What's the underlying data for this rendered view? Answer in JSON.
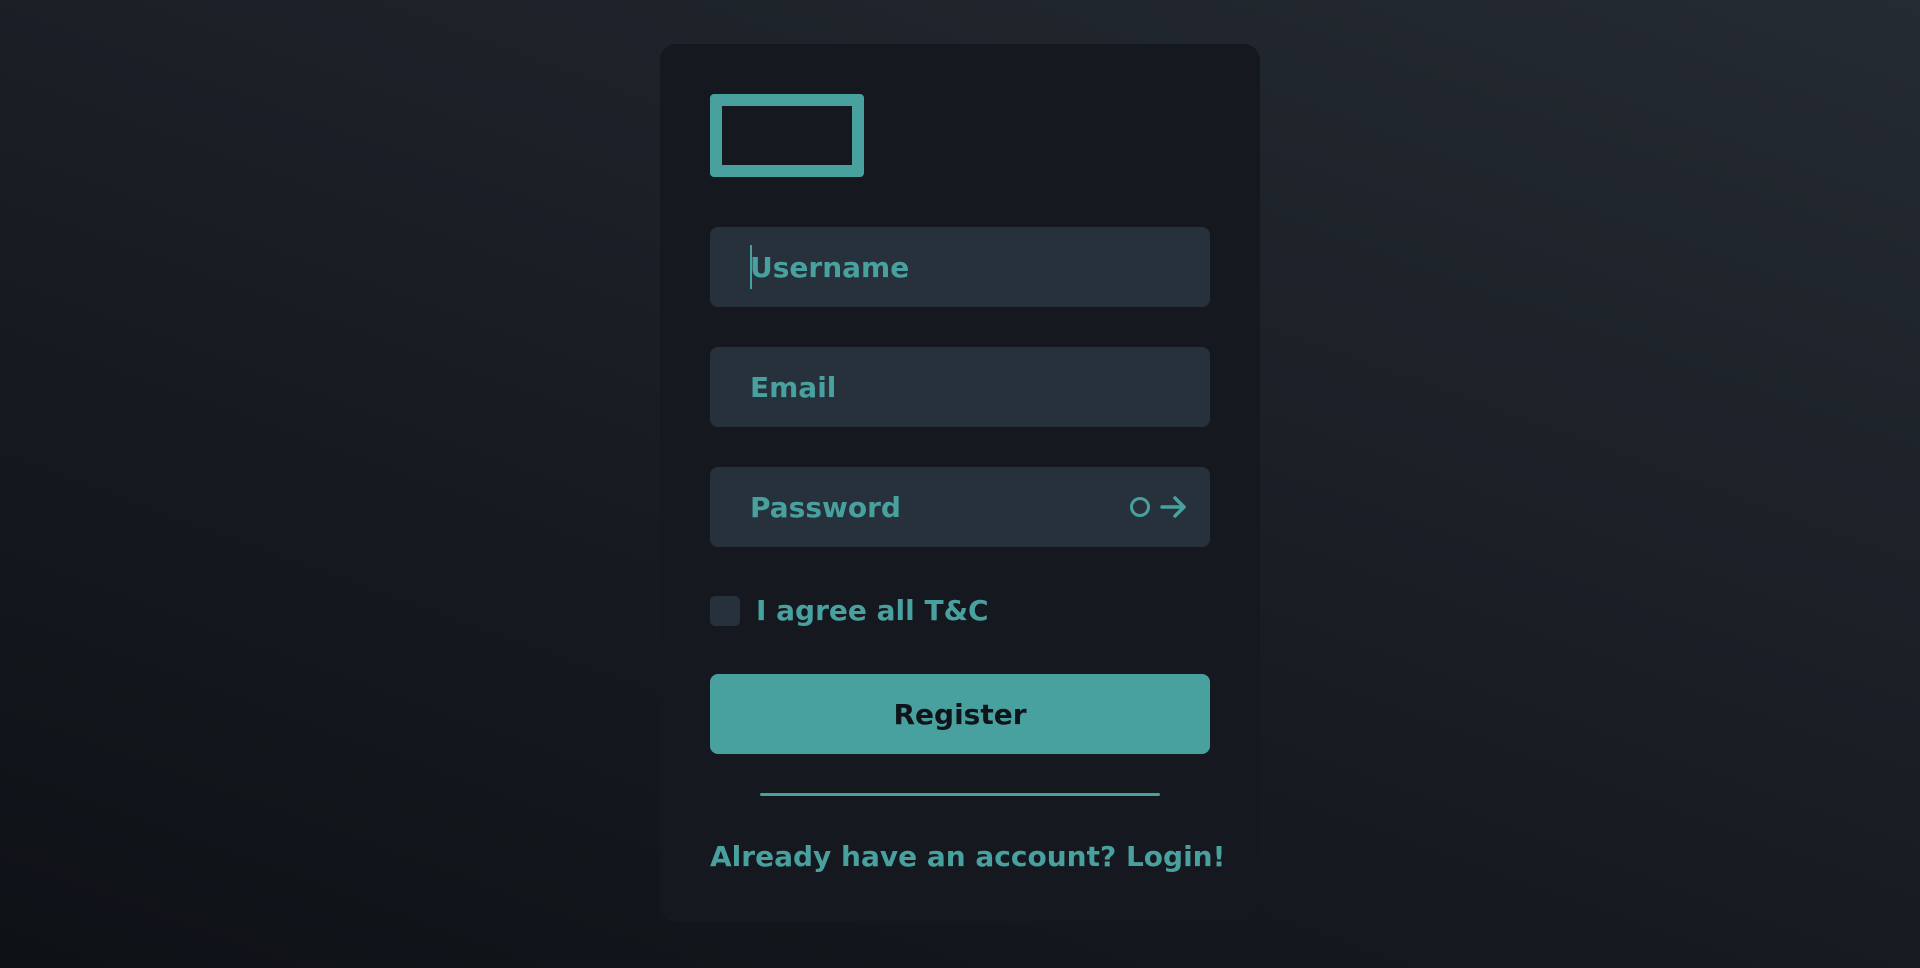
{
  "form": {
    "username_placeholder": "Username",
    "email_placeholder": "Email",
    "password_placeholder": "Password",
    "terms_label": "I agree all T&C",
    "terms_checked": false,
    "register_label": "Register",
    "login_link": "Already have an account? Login!"
  },
  "icons": {
    "logo": "logo-outline-rect",
    "password_toggle": "circle-icon",
    "password_submit": "arrow-right-icon"
  },
  "colors": {
    "accent": "#48a19f",
    "card_background": "#15181e",
    "field_background": "#26313c",
    "button_text": "#10141a"
  }
}
